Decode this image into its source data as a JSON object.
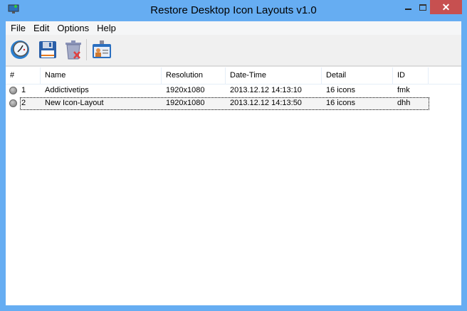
{
  "window": {
    "title": "Restore Desktop Icon Layouts v1.0",
    "close": "✕"
  },
  "menu": [
    "File",
    "Edit",
    "Options",
    "Help"
  ],
  "toolbar": {
    "icons": [
      "restore-clock-icon",
      "save-floppy-icon",
      "delete-trash-icon",
      "id-card-icon"
    ]
  },
  "columns": [
    "#",
    "Name",
    "Resolution",
    "Date-Time",
    "Detail",
    "ID"
  ],
  "rows": [
    {
      "num": "1",
      "name": "Addictivetips",
      "resolution": "1920x1080",
      "datetime": "2013.12.12 14:13:10",
      "detail": "16 icons",
      "id": "fmk"
    },
    {
      "num": "2",
      "name": "New Icon-Layout",
      "resolution": "1920x1080",
      "datetime": "2013.12.12 14:13:50",
      "detail": "16 icons",
      "id": "dhh"
    }
  ]
}
